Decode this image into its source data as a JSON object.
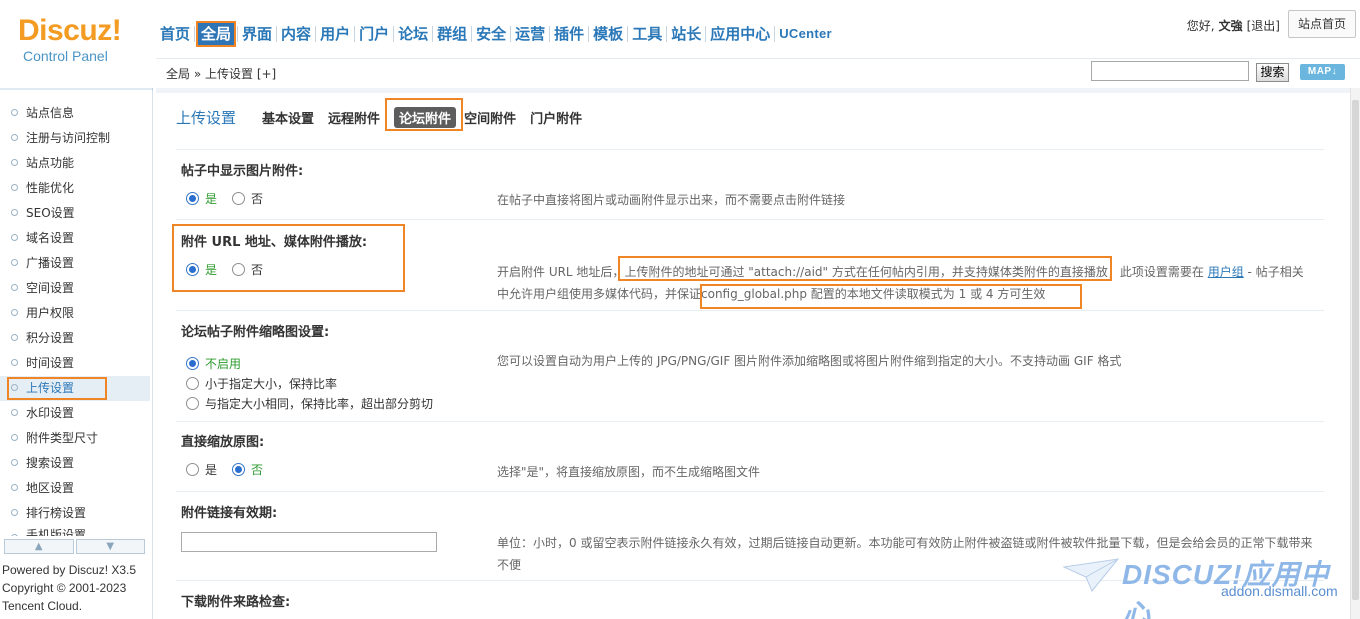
{
  "header": {
    "logo_main": "Discuz!",
    "logo_sub": "Control Panel",
    "nav": [
      "首页",
      "全局",
      "界面",
      "内容",
      "用户",
      "门户",
      "论坛",
      "群组",
      "安全",
      "运营",
      "插件",
      "模板",
      "工具",
      "站长",
      "应用中心",
      "UCenter"
    ],
    "active_nav": "全局",
    "greeting": "您好,",
    "username": "文強",
    "logout": "[退出]",
    "site_home": "站点首页"
  },
  "crumbbar": {
    "path": "全局 » 上传设置",
    "add": "[+]",
    "search_value": "",
    "search_button": "搜索",
    "map_button": "MAP↓"
  },
  "sidebar": {
    "items": [
      "站点信息",
      "注册与访问控制",
      "站点功能",
      "性能优化",
      "SEO设置",
      "域名设置",
      "广播设置",
      "空间设置",
      "用户权限",
      "积分设置",
      "时间设置",
      "上传设置",
      "水印设置",
      "附件类型尺寸",
      "搜索设置",
      "地区设置",
      "排行榜设置",
      "手机版设置"
    ],
    "active": "上传设置",
    "scroll_up": "▲",
    "scroll_down": "▼",
    "powered_1": "Powered by Discuz! X3.5",
    "powered_2": "Copyright © 2001-2023",
    "powered_3": "Tencent Cloud."
  },
  "main": {
    "title": "上传设置",
    "tabs": [
      "基本设置",
      "远程附件",
      "论坛附件",
      "空间附件",
      "门户附件"
    ],
    "current_tab": "论坛附件",
    "fields": {
      "f1": {
        "label": "帖子中显示图片附件:",
        "opt_yes": "是",
        "opt_no": "否",
        "tip": "在帖子中直接将图片或动画附件显示出来，而不需要点击附件链接"
      },
      "f2": {
        "label": "附件 URL 地址、媒体附件播放:",
        "opt_yes": "是",
        "opt_no": "否",
        "tip_a": "开启附件 URL 地址后，",
        "tip_b": "上传附件的地址可通过 \"attach://aid\" 方式在任何帖内引用，并支持媒体类附件的直接播放",
        "tip_c": "，此项设置需要在",
        "tip_link": "用户组",
        "tip_d": " - 帖子相关",
        "tip_e": "中允许用户组使用多媒体代码，并保证",
        "tip_f": "config_global.php 配置的本地文件读取模式为 1 或 4 方可生效"
      },
      "f3": {
        "label": "论坛帖子附件缩略图设置:",
        "opt1": "不启用",
        "opt2": "小于指定大小，保持比率",
        "opt3": "与指定大小相同，保持比率，超出部分剪切",
        "tip": "您可以设置自动为用户上传的 JPG/PNG/GIF 图片附件添加缩略图或将图片附件缩到指定的大小。不支持动画 GIF 格式"
      },
      "f4": {
        "label": "直接缩放原图:",
        "opt_yes": "是",
        "opt_no": "否",
        "tip": "选择\"是\"，将直接缩放原图，而不生成缩略图文件"
      },
      "f5": {
        "label": "附件链接有效期:",
        "value": "",
        "tip_1": "单位：小时，0 或留空表示附件链接永久有效，过期后链接自动更新。本功能可有效防止附件被盗链或附件被软件批量下载，但是会给会员的正常下载带来",
        "tip_2": "不便"
      },
      "f6": {
        "label": "下载附件来路检查:"
      }
    }
  },
  "watermark": {
    "logo": "DISCUZ!应用中心",
    "sub": "addon.dismall.com"
  },
  "colors": {
    "accent": "#2b78b8",
    "highlight": "#f08525",
    "logo": "#f39b22"
  }
}
